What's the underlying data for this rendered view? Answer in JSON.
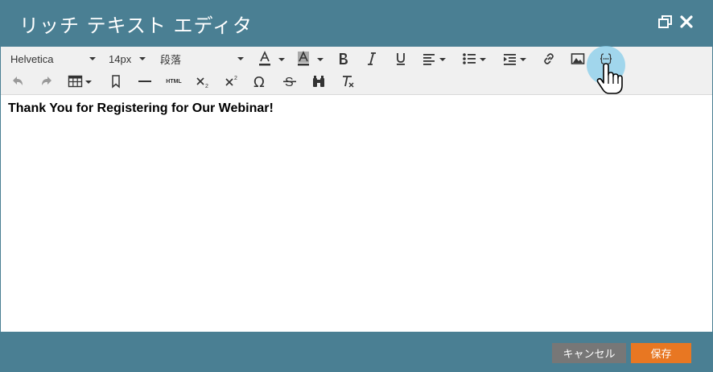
{
  "dialog": {
    "title": "リッチ テキスト エディタ",
    "restore_icon": "restore-window-icon",
    "close_icon": "close-icon"
  },
  "toolbar": {
    "font_family": "Helvetica",
    "font_size": "14px",
    "block_format": "段落",
    "row1_icons": [
      "text-color-icon",
      "background-color-icon",
      "bold-icon",
      "italic-icon",
      "underline-icon",
      "align-left-icon",
      "bullet-list-icon",
      "indent-icon",
      "link-icon",
      "image-icon",
      "insert-token-icon"
    ],
    "row2_icons": [
      "undo-icon",
      "redo-icon",
      "table-icon",
      "bookmark-icon",
      "horizontal-rule-icon",
      "html-icon",
      "subscript-icon",
      "superscript-icon",
      "special-character-icon",
      "strikethrough-icon",
      "find-replace-icon",
      "clear-formatting-icon"
    ],
    "html_label": "HTML"
  },
  "content": {
    "heading": "Thank You for Registering for Our Webinar!"
  },
  "footer": {
    "cancel_label": "キャンセル",
    "save_label": "保存"
  },
  "colors": {
    "header_bg": "#4a7f93",
    "toolbar_bg": "#f0f0f0",
    "cancel_bg": "#777777",
    "save_bg": "#e87722",
    "highlight": "#87ceeb"
  }
}
